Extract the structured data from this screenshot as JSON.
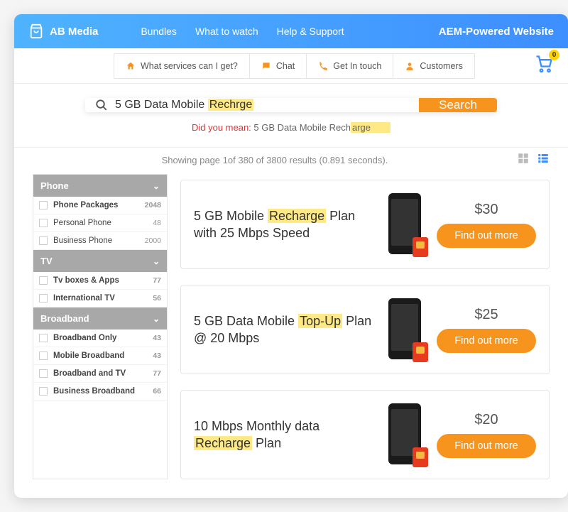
{
  "header": {
    "brand": "AB Media",
    "nav": [
      "Bundles",
      "What to watch",
      "Help & Support"
    ],
    "tagline": "AEM-Powered Website"
  },
  "subnav": {
    "items": [
      {
        "label": "What services can I get?",
        "icon": "home"
      },
      {
        "label": "Chat",
        "icon": "chat"
      },
      {
        "label": "Get In touch",
        "icon": "phone"
      },
      {
        "label": "Customers",
        "icon": "user"
      }
    ],
    "cart_count": "0"
  },
  "search": {
    "value_prefix": "5 GB Data Mobile ",
    "value_highlight": "Rechrge",
    "button": "Search",
    "dym_label": "Did you mean:",
    "dym_prefix": " 5 GB Data Mobile Rech",
    "dym_highlight": "arge"
  },
  "meta": {
    "text": "Showing page 1of 380 of 3800 results (0.891 seconds)."
  },
  "facets": [
    {
      "title": "Phone",
      "items": [
        {
          "label": "Phone Packages",
          "count": "2048",
          "bold": true
        },
        {
          "label": "Personal Phone",
          "count": "48"
        },
        {
          "label": "Business Phone",
          "count": "2000"
        }
      ]
    },
    {
      "title": "TV",
      "items": [
        {
          "label": "Tv boxes & Apps",
          "count": "77",
          "bold": true
        },
        {
          "label": "International TV",
          "count": "56",
          "bold": true
        }
      ]
    },
    {
      "title": "Broadband",
      "items": [
        {
          "label": "Broadband Only",
          "count": "43",
          "bold": true
        },
        {
          "label": "Mobile Broadband",
          "count": "43",
          "bold": true
        },
        {
          "label": "Broadband and TV",
          "count": "77",
          "bold": true
        },
        {
          "label": "Business Broadband",
          "count": "66",
          "bold": true
        }
      ]
    }
  ],
  "results": [
    {
      "title_a": "5 GB Mobile ",
      "title_hl": "Recharge",
      "title_b": " Plan with 25 Mbps Speed",
      "price": "$30",
      "cta": "Find out more"
    },
    {
      "title_a": "5 GB Data Mobile ",
      "title_hl": "Top-Up",
      "title_b": " Plan @ 20 Mbps",
      "price": "$25",
      "cta": "Find out more"
    },
    {
      "title_a": "10 Mbps Monthly data ",
      "title_hl": "Recharge",
      "title_b": " Plan",
      "price": "$20",
      "cta": "Find out more"
    }
  ],
  "colors": {
    "accent": "#f7941d",
    "highlight": "#ffe985"
  }
}
